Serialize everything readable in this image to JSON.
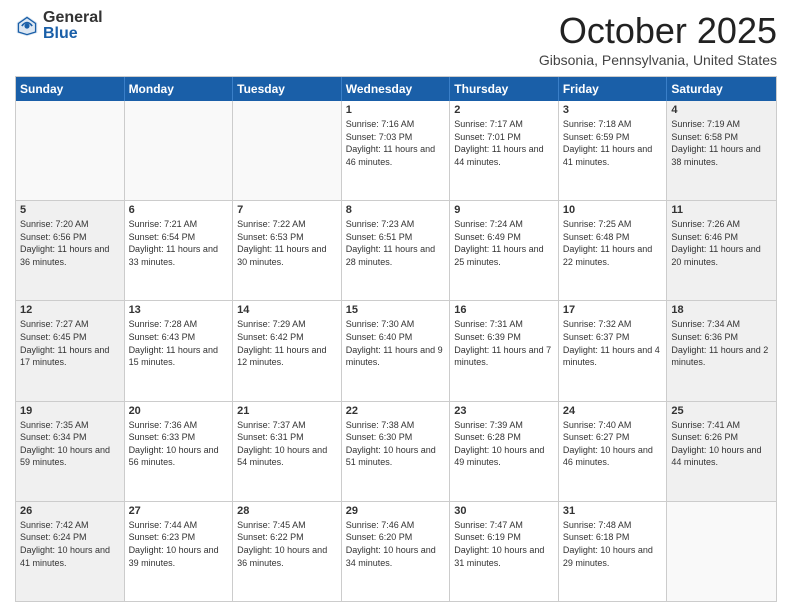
{
  "logo": {
    "general": "General",
    "blue": "Blue"
  },
  "title": "October 2025",
  "location": "Gibsonia, Pennsylvania, United States",
  "days": [
    "Sunday",
    "Monday",
    "Tuesday",
    "Wednesday",
    "Thursday",
    "Friday",
    "Saturday"
  ],
  "weeks": [
    [
      {
        "day": "",
        "info": "",
        "empty": true
      },
      {
        "day": "",
        "info": "",
        "empty": true
      },
      {
        "day": "",
        "info": "",
        "empty": true
      },
      {
        "day": "1",
        "info": "Sunrise: 7:16 AM\nSunset: 7:03 PM\nDaylight: 11 hours and 46 minutes.",
        "shaded": false
      },
      {
        "day": "2",
        "info": "Sunrise: 7:17 AM\nSunset: 7:01 PM\nDaylight: 11 hours and 44 minutes.",
        "shaded": false
      },
      {
        "day": "3",
        "info": "Sunrise: 7:18 AM\nSunset: 6:59 PM\nDaylight: 11 hours and 41 minutes.",
        "shaded": false
      },
      {
        "day": "4",
        "info": "Sunrise: 7:19 AM\nSunset: 6:58 PM\nDaylight: 11 hours and 38 minutes.",
        "shaded": true
      }
    ],
    [
      {
        "day": "5",
        "info": "Sunrise: 7:20 AM\nSunset: 6:56 PM\nDaylight: 11 hours and 36 minutes.",
        "shaded": true
      },
      {
        "day": "6",
        "info": "Sunrise: 7:21 AM\nSunset: 6:54 PM\nDaylight: 11 hours and 33 minutes.",
        "shaded": false
      },
      {
        "day": "7",
        "info": "Sunrise: 7:22 AM\nSunset: 6:53 PM\nDaylight: 11 hours and 30 minutes.",
        "shaded": false
      },
      {
        "day": "8",
        "info": "Sunrise: 7:23 AM\nSunset: 6:51 PM\nDaylight: 11 hours and 28 minutes.",
        "shaded": false
      },
      {
        "day": "9",
        "info": "Sunrise: 7:24 AM\nSunset: 6:49 PM\nDaylight: 11 hours and 25 minutes.",
        "shaded": false
      },
      {
        "day": "10",
        "info": "Sunrise: 7:25 AM\nSunset: 6:48 PM\nDaylight: 11 hours and 22 minutes.",
        "shaded": false
      },
      {
        "day": "11",
        "info": "Sunrise: 7:26 AM\nSunset: 6:46 PM\nDaylight: 11 hours and 20 minutes.",
        "shaded": true
      }
    ],
    [
      {
        "day": "12",
        "info": "Sunrise: 7:27 AM\nSunset: 6:45 PM\nDaylight: 11 hours and 17 minutes.",
        "shaded": true
      },
      {
        "day": "13",
        "info": "Sunrise: 7:28 AM\nSunset: 6:43 PM\nDaylight: 11 hours and 15 minutes.",
        "shaded": false
      },
      {
        "day": "14",
        "info": "Sunrise: 7:29 AM\nSunset: 6:42 PM\nDaylight: 11 hours and 12 minutes.",
        "shaded": false
      },
      {
        "day": "15",
        "info": "Sunrise: 7:30 AM\nSunset: 6:40 PM\nDaylight: 11 hours and 9 minutes.",
        "shaded": false
      },
      {
        "day": "16",
        "info": "Sunrise: 7:31 AM\nSunset: 6:39 PM\nDaylight: 11 hours and 7 minutes.",
        "shaded": false
      },
      {
        "day": "17",
        "info": "Sunrise: 7:32 AM\nSunset: 6:37 PM\nDaylight: 11 hours and 4 minutes.",
        "shaded": false
      },
      {
        "day": "18",
        "info": "Sunrise: 7:34 AM\nSunset: 6:36 PM\nDaylight: 11 hours and 2 minutes.",
        "shaded": true
      }
    ],
    [
      {
        "day": "19",
        "info": "Sunrise: 7:35 AM\nSunset: 6:34 PM\nDaylight: 10 hours and 59 minutes.",
        "shaded": true
      },
      {
        "day": "20",
        "info": "Sunrise: 7:36 AM\nSunset: 6:33 PM\nDaylight: 10 hours and 56 minutes.",
        "shaded": false
      },
      {
        "day": "21",
        "info": "Sunrise: 7:37 AM\nSunset: 6:31 PM\nDaylight: 10 hours and 54 minutes.",
        "shaded": false
      },
      {
        "day": "22",
        "info": "Sunrise: 7:38 AM\nSunset: 6:30 PM\nDaylight: 10 hours and 51 minutes.",
        "shaded": false
      },
      {
        "day": "23",
        "info": "Sunrise: 7:39 AM\nSunset: 6:28 PM\nDaylight: 10 hours and 49 minutes.",
        "shaded": false
      },
      {
        "day": "24",
        "info": "Sunrise: 7:40 AM\nSunset: 6:27 PM\nDaylight: 10 hours and 46 minutes.",
        "shaded": false
      },
      {
        "day": "25",
        "info": "Sunrise: 7:41 AM\nSunset: 6:26 PM\nDaylight: 10 hours and 44 minutes.",
        "shaded": true
      }
    ],
    [
      {
        "day": "26",
        "info": "Sunrise: 7:42 AM\nSunset: 6:24 PM\nDaylight: 10 hours and 41 minutes.",
        "shaded": true
      },
      {
        "day": "27",
        "info": "Sunrise: 7:44 AM\nSunset: 6:23 PM\nDaylight: 10 hours and 39 minutes.",
        "shaded": false
      },
      {
        "day": "28",
        "info": "Sunrise: 7:45 AM\nSunset: 6:22 PM\nDaylight: 10 hours and 36 minutes.",
        "shaded": false
      },
      {
        "day": "29",
        "info": "Sunrise: 7:46 AM\nSunset: 6:20 PM\nDaylight: 10 hours and 34 minutes.",
        "shaded": false
      },
      {
        "day": "30",
        "info": "Sunrise: 7:47 AM\nSunset: 6:19 PM\nDaylight: 10 hours and 31 minutes.",
        "shaded": false
      },
      {
        "day": "31",
        "info": "Sunrise: 7:48 AM\nSunset: 6:18 PM\nDaylight: 10 hours and 29 minutes.",
        "shaded": false
      },
      {
        "day": "",
        "info": "",
        "empty": true
      }
    ]
  ]
}
